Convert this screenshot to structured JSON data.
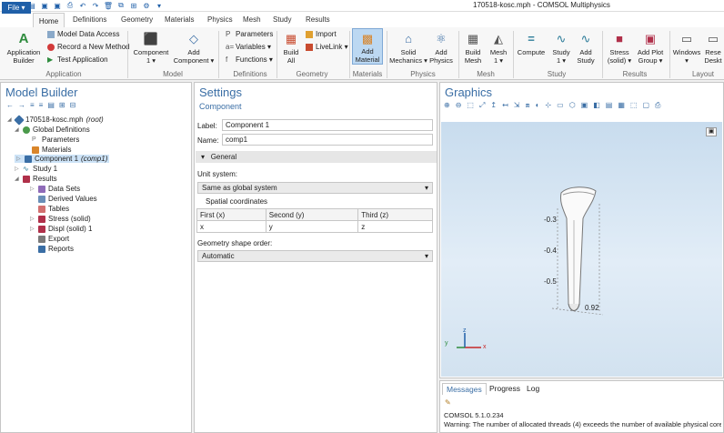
{
  "window": {
    "title": "170518-kosc.mph - COMSOL Multiphysics"
  },
  "menu": {
    "file": "File",
    "tabs": [
      "Home",
      "Definitions",
      "Geometry",
      "Materials",
      "Physics",
      "Mesh",
      "Study",
      "Results"
    ]
  },
  "ribbon": {
    "application": {
      "builder": [
        "Application",
        "Builder"
      ],
      "data_access": "Model Data Access",
      "record": "Record a New Method",
      "test": "Test Application",
      "group": "Application"
    },
    "model": {
      "component": [
        "Component",
        "1 ▾"
      ],
      "add_component": [
        "Add",
        "Component ▾"
      ],
      "group": "Model"
    },
    "definitions": {
      "parameters": "Parameters",
      "variables": "Variables ▾",
      "functions": "Functions ▾",
      "group": "Definitions"
    },
    "geometry": {
      "build_all": [
        "Build",
        "All"
      ],
      "import": "Import",
      "livelink": "LiveLink ▾",
      "group": "Geometry"
    },
    "materials": {
      "add_material": [
        "Add",
        "Material"
      ],
      "group": "Materials"
    },
    "physics": {
      "solid": [
        "Solid",
        "Mechanics ▾"
      ],
      "add_physics": [
        "Add",
        "Physics"
      ],
      "group": "Physics"
    },
    "mesh": {
      "build_mesh": [
        "Build",
        "Mesh"
      ],
      "mesh1": [
        "Mesh",
        "1 ▾"
      ],
      "group": "Mesh"
    },
    "study": {
      "compute": "Compute",
      "study1": [
        "Study",
        "1 ▾"
      ],
      "add_study": [
        "Add",
        "Study"
      ],
      "group": "Study"
    },
    "results": {
      "stress": [
        "Stress",
        "(solid) ▾"
      ],
      "add_plot": [
        "Add Plot",
        "Group ▾"
      ],
      "group": "Results"
    },
    "layout": {
      "windows": [
        "Windows",
        "▾"
      ],
      "reset": [
        "Rese",
        "Deskt"
      ],
      "group": "Layout"
    }
  },
  "model_builder": {
    "title": "Model Builder",
    "tree": [
      {
        "label": "170518-kosc.mph",
        "suffix": "(root)"
      },
      {
        "label": "Global Definitions"
      },
      {
        "label": "Parameters"
      },
      {
        "label": "Materials"
      },
      {
        "label": "Component 1",
        "suffix": "(comp1)"
      },
      {
        "label": "Study 1"
      },
      {
        "label": "Results"
      },
      {
        "label": "Data Sets"
      },
      {
        "label": "Derived Values"
      },
      {
        "label": "Tables"
      },
      {
        "label": "Stress (solid)"
      },
      {
        "label": "Displ (solid) 1"
      },
      {
        "label": "Export"
      },
      {
        "label": "Reports"
      }
    ]
  },
  "settings": {
    "title": "Settings",
    "subtitle": "Component",
    "label_field": {
      "label": "Label:",
      "value": "Component 1"
    },
    "name_field": {
      "label": "Name:",
      "value": "comp1"
    },
    "section": "General",
    "unit_system": {
      "label": "Unit system:",
      "value": "Same as global system"
    },
    "spatial": {
      "label": "Spatial coordinates",
      "headers": [
        "First (x)",
        "Second (y)",
        "Third (z)"
      ],
      "values": [
        "x",
        "y",
        "z"
      ]
    },
    "shape_order": {
      "label": "Geometry shape order:",
      "value": "Automatic"
    }
  },
  "graphics": {
    "title": "Graphics",
    "axis_labels": [
      "-0.3",
      "-0.4",
      "-0.5",
      "0.92"
    ],
    "triad": {
      "x": "x",
      "y": "y",
      "z": "z"
    }
  },
  "messages": {
    "tabs": [
      "Messages",
      "Progress",
      "Log"
    ],
    "lines": [
      "COMSOL 5.1.0.234",
      "Warning: The number of allocated threads (4) exceeds the number of available physical cores"
    ]
  }
}
